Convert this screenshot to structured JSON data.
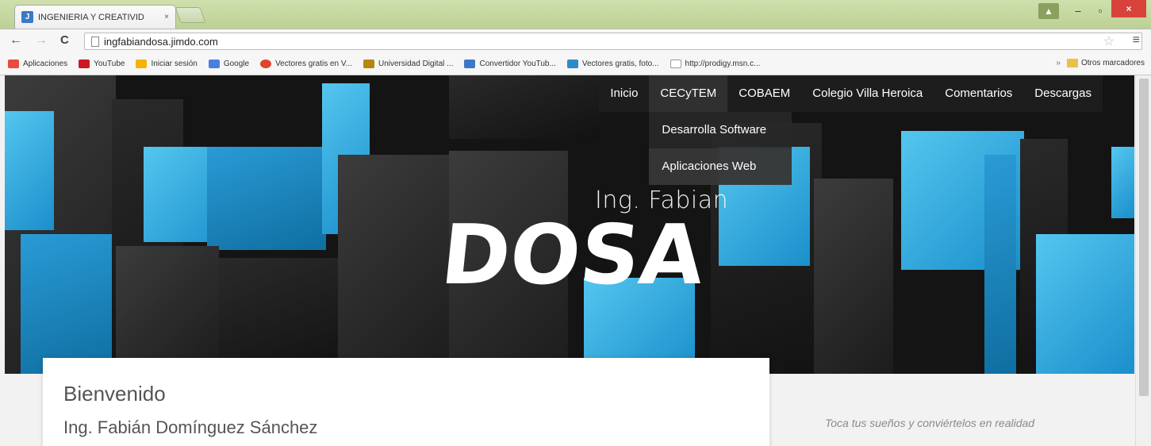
{
  "browser": {
    "tab_title": "INGENIERIA Y CREATIVID",
    "tab_close": "×",
    "url": "ingfabiandosa.jimdo.com",
    "back": "←",
    "forward": "→",
    "reload": "C",
    "star": "☆",
    "menu": "≡",
    "win_minimize": "–",
    "win_maximize": "▫",
    "win_close": "×",
    "win_user": "▲",
    "accent": "#d9423a"
  },
  "bookmarks": [
    {
      "label": "Aplicaciones",
      "color": "#e74c3c"
    },
    {
      "label": "YouTube",
      "color": "#cc181e"
    },
    {
      "label": "Iniciar sesión",
      "color": "#f4b400"
    },
    {
      "label": "Google",
      "color": "#4a7fe0"
    },
    {
      "label": "Vectores gratis en V...",
      "color": "#e0452a"
    },
    {
      "label": "Universidad Digital ...",
      "color": "#b8860b"
    },
    {
      "label": "Convertidor YouTub...",
      "color": "#3b79c6"
    },
    {
      "label": "Vectores gratis, foto...",
      "color": "#2d8bc9"
    },
    {
      "label": "http://prodigy.msn.c...",
      "color": "#ffffff"
    }
  ],
  "other_bookmarks": "Otros marcadores",
  "site": {
    "nav": [
      "Inicio",
      "CECyTEM",
      "COBAEM",
      "Colegio Villa Heroica",
      "Comentarios",
      "Descargas"
    ],
    "dropdown": [
      "Desarrolla Software",
      "Aplicaciones Web"
    ],
    "logo_sub": "Ing. Fabian",
    "logo_main": "DOSA",
    "welcome": "Bienvenido",
    "author": "Ing. Fabián Domínguez Sánchez",
    "tagline": "Toca tus sueños y conviértelos en realidad"
  }
}
